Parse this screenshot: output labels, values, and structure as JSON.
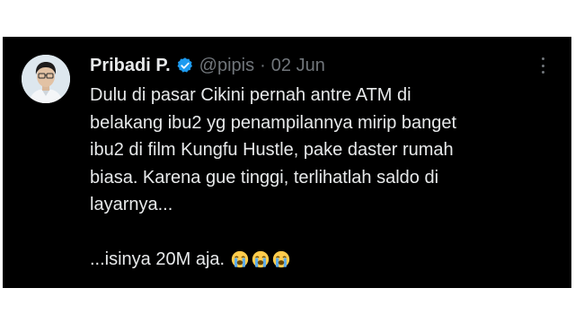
{
  "tweet": {
    "author": {
      "display_name": "Pribadi P.",
      "handle": "@pipis",
      "verified_icon": "verified-badge-icon",
      "avatar_icon": "avatar-portrait"
    },
    "separator": "·",
    "date": "02 Jun",
    "more_icon": "more-options-icon",
    "text_lines": [
      "Dulu di pasar Cikini pernah antre ATM di",
      "belakang ibu2 yg penampilannya mirip banget",
      "ibu2 di film Kungfu Hustle, pake daster rumah",
      "biasa. Karena gue tinggi, terlihatlah saldo di",
      "layarnya..."
    ],
    "last_line": "...isinya 20M aja.",
    "emojis": [
      "loudly-crying-face-icon",
      "loudly-crying-face-icon",
      "loudly-crying-face-icon"
    ]
  },
  "colors": {
    "background": "#000000",
    "primary_text": "#e7e9ea",
    "secondary_text": "#71767b",
    "verified_blue": "#1d9bf0"
  }
}
